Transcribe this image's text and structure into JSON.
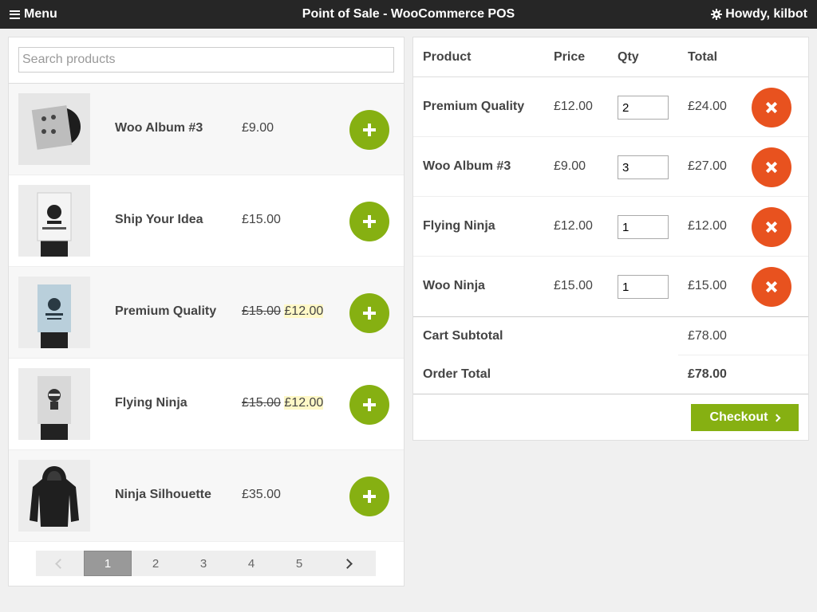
{
  "header": {
    "menu_label": "Menu",
    "title": "Point of Sale - WooCommerce POS",
    "user_greeting": "Howdy, kilbot"
  },
  "search": {
    "placeholder": "Search products",
    "value": ""
  },
  "products": [
    {
      "name": "Woo Album #3",
      "price": "£9.00",
      "regular_price": "",
      "sale_price": "",
      "icon": "album-thumbnail"
    },
    {
      "name": "Ship Your Idea",
      "price": "£15.00",
      "regular_price": "",
      "sale_price": "",
      "icon": "poster-thumbnail"
    },
    {
      "name": "Premium Quality",
      "price": "",
      "regular_price": "£15.00",
      "sale_price": "£12.00",
      "icon": "poster-thumbnail"
    },
    {
      "name": "Flying Ninja",
      "price": "",
      "regular_price": "£15.00",
      "sale_price": "£12.00",
      "icon": "poster-thumbnail"
    },
    {
      "name": "Ninja Silhouette",
      "price": "£35.00",
      "regular_price": "",
      "sale_price": "",
      "icon": "hoodie-thumbnail"
    }
  ],
  "pagination": {
    "pages": [
      "1",
      "2",
      "3",
      "4",
      "5"
    ],
    "current": "1"
  },
  "cart": {
    "columns": {
      "product": "Product",
      "price": "Price",
      "qty": "Qty",
      "total": "Total"
    },
    "items": [
      {
        "name": "Premium Quality",
        "price": "£12.00",
        "qty": "2",
        "total": "£24.00"
      },
      {
        "name": "Woo Album #3",
        "price": "£9.00",
        "qty": "3",
        "total": "£27.00"
      },
      {
        "name": "Flying Ninja",
        "price": "£12.00",
        "qty": "1",
        "total": "£12.00"
      },
      {
        "name": "Woo Ninja",
        "price": "£15.00",
        "qty": "1",
        "total": "£15.00"
      }
    ],
    "subtotal_label": "Cart Subtotal",
    "subtotal_value": "£78.00",
    "order_total_label": "Order Total",
    "order_total_value": "£78.00",
    "checkout_label": "Checkout"
  },
  "colors": {
    "accent_green": "#86b012",
    "remove_orange": "#e8521f",
    "topbar": "#262626",
    "sale_highlight": "#fff8c7"
  }
}
